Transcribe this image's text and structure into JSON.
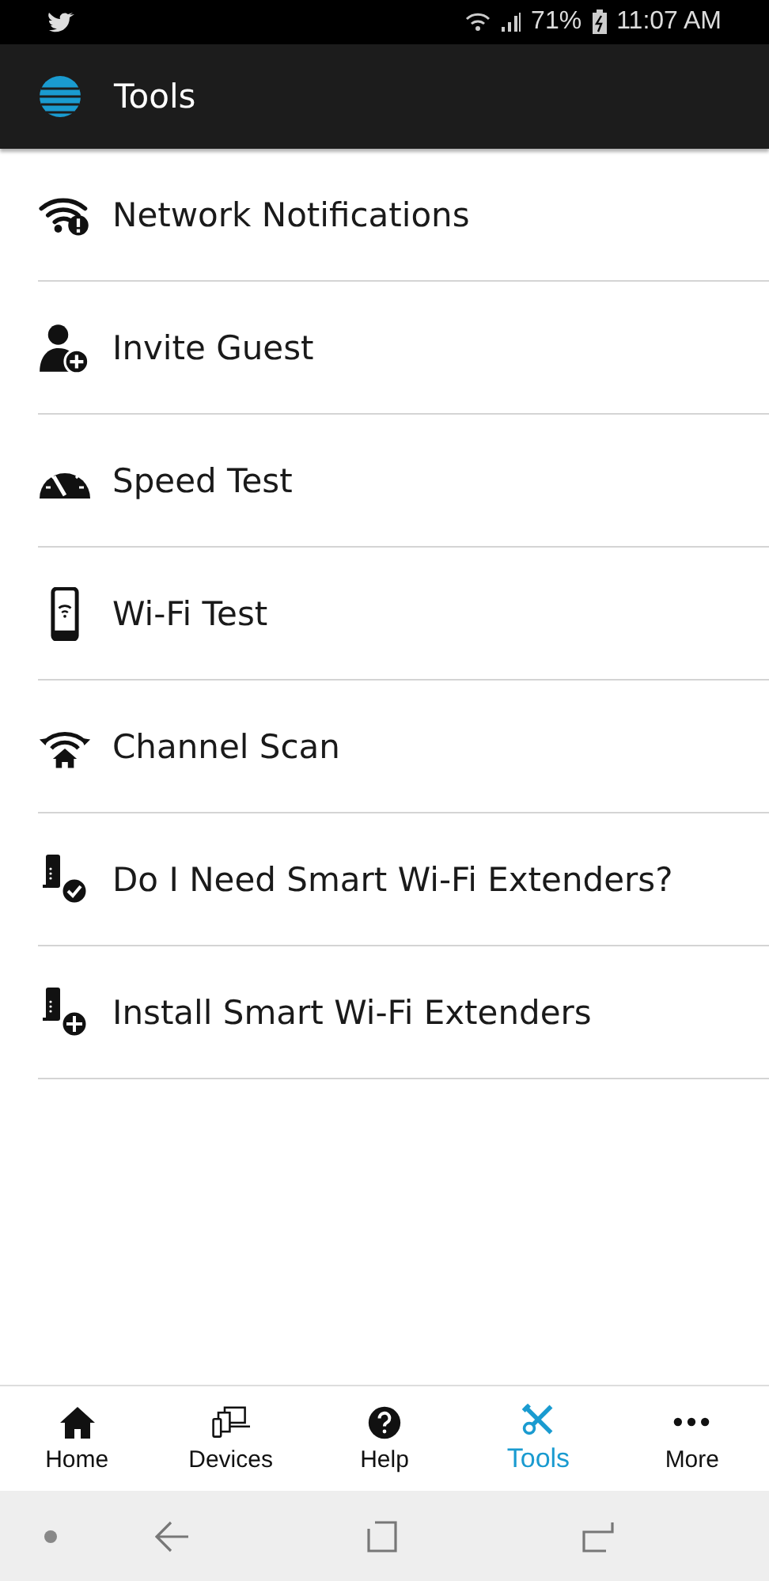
{
  "status_bar": {
    "battery": "71%",
    "time": "11:07 AM"
  },
  "app_bar": {
    "title": "Tools"
  },
  "tools": [
    {
      "label": "Network Notifications",
      "kind": "wifi-alert"
    },
    {
      "label": "Invite Guest",
      "kind": "person-add"
    },
    {
      "label": "Speed Test",
      "kind": "gauge"
    },
    {
      "label": "Wi-Fi Test",
      "kind": "phone-wifi"
    },
    {
      "label": "Channel Scan",
      "kind": "wifi-home"
    },
    {
      "label": "Do I Need Smart Wi-Fi Extenders?",
      "kind": "extender-check"
    },
    {
      "label": "Install Smart Wi-Fi Extenders",
      "kind": "extender-add"
    }
  ],
  "bottom_nav": [
    {
      "label": "Home",
      "kind": "home",
      "selected": false
    },
    {
      "label": "Devices",
      "kind": "devices",
      "selected": false
    },
    {
      "label": "Help",
      "kind": "help",
      "selected": false
    },
    {
      "label": "Tools",
      "kind": "tools",
      "selected": true
    },
    {
      "label": "More",
      "kind": "more",
      "selected": false
    }
  ]
}
